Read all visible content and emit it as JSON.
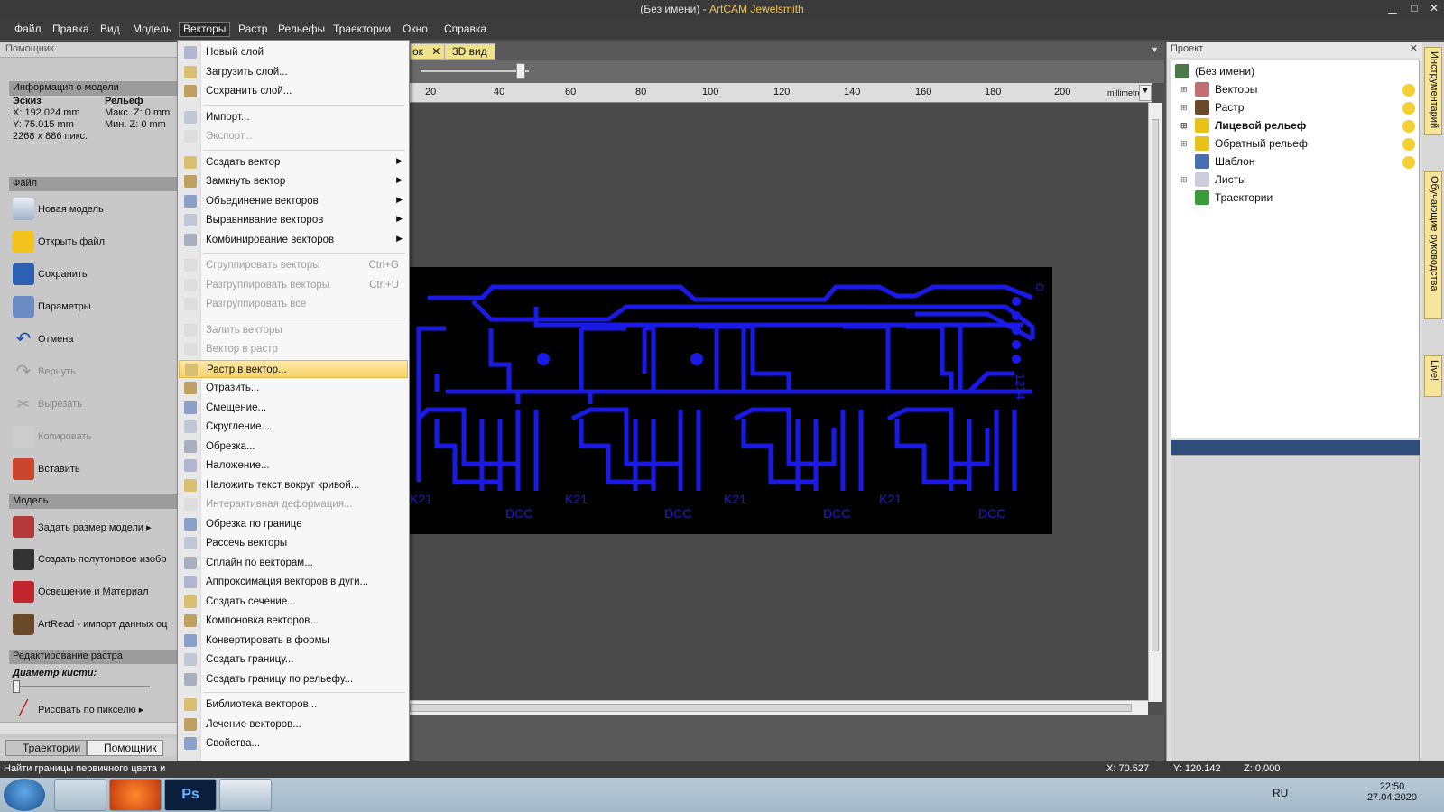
{
  "window": {
    "title_prefix": "(Без имени) - ",
    "title_app": "ArtCAM Jewelsmith",
    "minimize": "▁",
    "maximize": "□",
    "close": "✕"
  },
  "menubar": [
    "Файл",
    "Правка",
    "Вид",
    "Модель",
    "Векторы",
    "Растр",
    "Рельефы",
    "Траектории",
    "Окно",
    "Справка"
  ],
  "left_panel": {
    "header": "Помощник",
    "model_info": {
      "title": "Информация о модели",
      "sketch": "Эскиз",
      "relief": "Рельеф",
      "x": "X: 192.024 mm",
      "y": "Y: 75.015 mm",
      "px": "2268 x 886 пикс.",
      "max_z": "Макс. Z: 0 mm",
      "min_z": "Мин. Z: 0 mm"
    },
    "file_section": "Файл",
    "file_items": [
      "Новая модель",
      "Открыть файл",
      "Сохранить",
      "Параметры",
      "Отмена",
      "Вернуть",
      "Вырезать",
      "Копировать",
      "Вставить"
    ],
    "model_section": "Модель",
    "model_items": [
      "Задать размер модели ▸",
      "Создать полутоновое изобр",
      "Освещение и Материал",
      "ArtRead - импорт данных оц"
    ],
    "raster_section": "Редактирование растра",
    "brush_label": "Диаметр кисти:",
    "pixel_paint": "Рисовать по пикселю ▸",
    "tabs": [
      "Траектории",
      "Помощник"
    ]
  },
  "dropdown": [
    {
      "label": "Новый слой",
      "disabled": false
    },
    {
      "label": "Загрузить слой...",
      "disabled": false
    },
    {
      "label": "Сохранить слой...",
      "disabled": false
    },
    {
      "sep": true
    },
    {
      "label": "Импорт...",
      "disabled": false
    },
    {
      "label": "Экспорт...",
      "disabled": true
    },
    {
      "sep": true
    },
    {
      "label": "Создать вектор",
      "disabled": false,
      "sub": true
    },
    {
      "label": "Замкнуть вектор",
      "disabled": false,
      "sub": true
    },
    {
      "label": "Объединение векторов",
      "disabled": false,
      "sub": true
    },
    {
      "label": "Выравнивание векторов",
      "disabled": false,
      "sub": true
    },
    {
      "label": "Комбинирование векторов",
      "disabled": false,
      "sub": true
    },
    {
      "sep": true
    },
    {
      "label": "Сгруппировать векторы",
      "disabled": true,
      "shortcut": "Ctrl+G"
    },
    {
      "label": "Разгруппировать векторы",
      "disabled": true,
      "shortcut": "Ctrl+U"
    },
    {
      "label": "Разгруппировать все",
      "disabled": true
    },
    {
      "sep": true
    },
    {
      "label": "Залить векторы",
      "disabled": true
    },
    {
      "label": "Вектор в растр",
      "disabled": true
    },
    {
      "label": "Растр в вектор...",
      "disabled": false,
      "highlight": true
    },
    {
      "label": "Отразить...",
      "disabled": false
    },
    {
      "label": "Смещение...",
      "disabled": false
    },
    {
      "label": "Скругление...",
      "disabled": false
    },
    {
      "label": "Обрезка...",
      "disabled": false
    },
    {
      "label": "Наложение...",
      "disabled": false
    },
    {
      "label": "Наложить текст вокруг кривой...",
      "disabled": false
    },
    {
      "label": "Интерактивная деформация...",
      "disabled": true
    },
    {
      "label": "Обрезка по границе",
      "disabled": false
    },
    {
      "label": "Рассечь векторы",
      "disabled": false
    },
    {
      "label": "Сплайн по векторам...",
      "disabled": false
    },
    {
      "label": "Аппроксимация векторов в дуги...",
      "disabled": false
    },
    {
      "label": "Создать сечение...",
      "disabled": false
    },
    {
      "label": "Компоновка векторов...",
      "disabled": false
    },
    {
      "label": "Конвертировать в формы",
      "disabled": false
    },
    {
      "label": "Создать границу...",
      "disabled": false
    },
    {
      "label": "Создать границу по рельефу...",
      "disabled": false
    },
    {
      "sep": true
    },
    {
      "label": "Библиотека векторов...",
      "disabled": false
    },
    {
      "label": "Лечение векторов...",
      "disabled": false
    },
    {
      "label": "Свойства...",
      "disabled": false
    }
  ],
  "view_tabs": [
    "ок",
    "3D вид"
  ],
  "ruler": {
    "labels": [
      "20",
      "40",
      "60",
      "80",
      "100",
      "120",
      "140",
      "160",
      "180",
      "200"
    ],
    "unit": "millimetres"
  },
  "pcb": {
    "labels": [
      "K21",
      "DCC",
      "K21",
      "DCC",
      "K21",
      "DCC",
      "K21",
      "DCC"
    ],
    "side_text": "1234",
    "side_o": "O",
    "trace_color": "#1a1ae6"
  },
  "project": {
    "header": "Проект",
    "tree": [
      "(Без имени)",
      "Векторы",
      "Растр",
      "Лицевой рельеф",
      "Обратный рельеф",
      "Шаблон",
      "Листы",
      "Траектории"
    ]
  },
  "right_tabs": [
    "Инструментарий",
    "Обучающие руководства",
    "Live!"
  ],
  "status": {
    "hint": "Найти границы первичного цвета и",
    "x": "X: 70.527",
    "y": "Y: 120.142",
    "z": "Z: 0.000"
  },
  "taskbar": {
    "lang": "RU",
    "time": "22:50",
    "date": "27.04.2020"
  }
}
